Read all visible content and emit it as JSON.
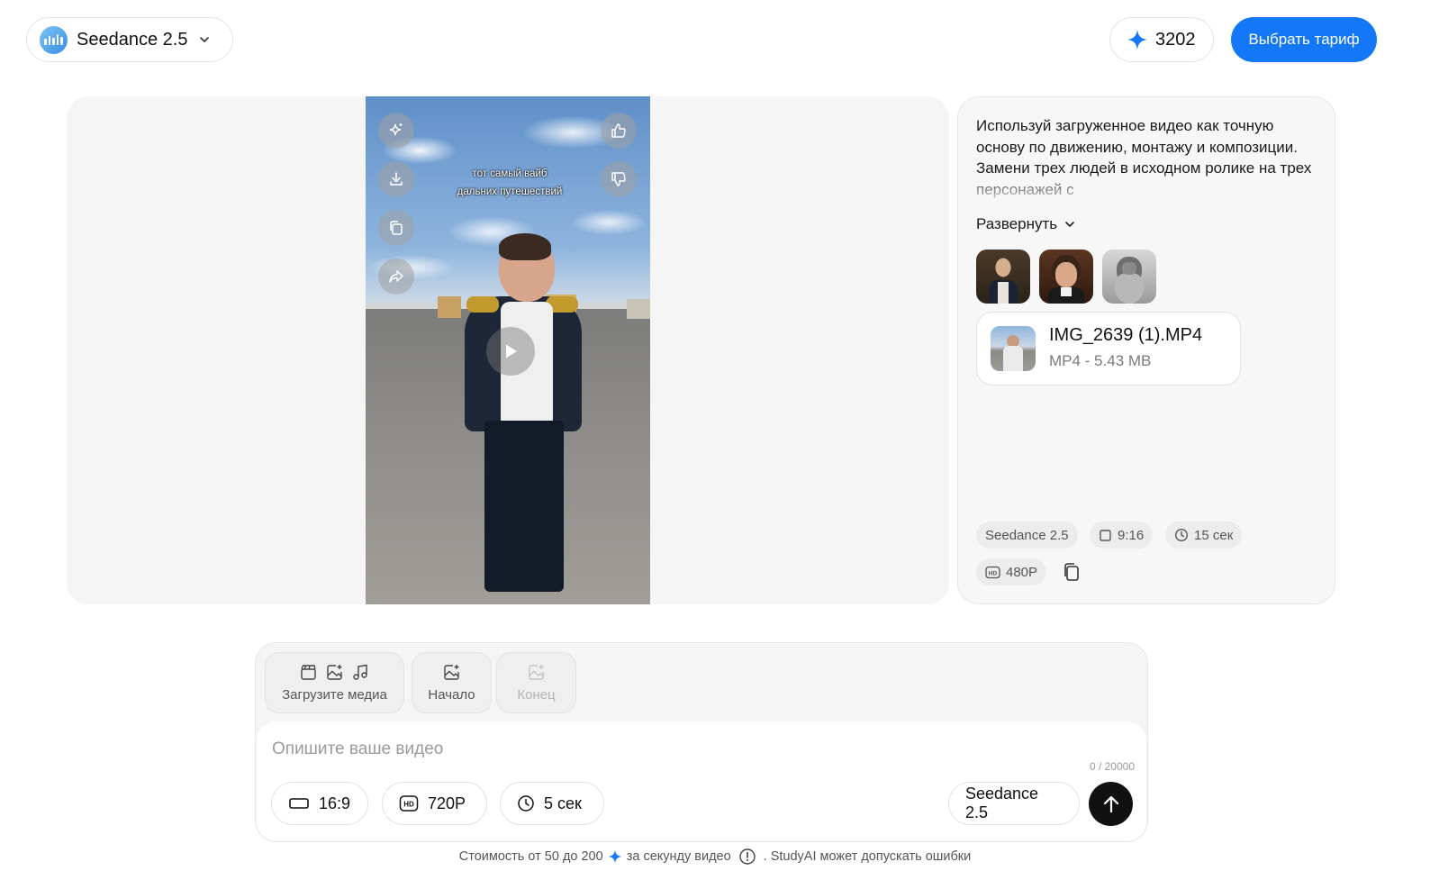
{
  "header": {
    "model_name": "Seedance 2.5",
    "credits": "3202",
    "tariff_button": "Выбрать тариф"
  },
  "video": {
    "caption_line1": "тот самый вайб",
    "caption_line2": "дальних путешествий"
  },
  "info": {
    "prompt": "Используй загруженное видео как точную основу по движению, монтажу и композиции. Замени трех людей в исходном ролике на трех персонажей с",
    "expand_label": "Развернуть",
    "file": {
      "name": "IMG_2639 (1).MP4",
      "meta": "MP4 - 5.43 MB"
    },
    "tags": {
      "model": "Seedance 2.5",
      "ratio": "9:16",
      "duration": "15 сек",
      "quality": "480P"
    }
  },
  "composer": {
    "upload_label": "Загрузите медиа",
    "start_label": "Начало",
    "end_label": "Конец",
    "placeholder": "Опишите ваше видео",
    "counter": "0 / 20000",
    "ratio": "16:9",
    "quality": "720P",
    "duration": "5 сек",
    "model": "Seedance 2.5"
  },
  "footer": {
    "cost_prefix": "Стоимость от 50 до 200",
    "cost_suffix": "за секунду видео",
    "disclaimer": ". StudyAI может допускать ошибки"
  },
  "colors": {
    "accent": "#1477f8",
    "send": "#111111"
  }
}
